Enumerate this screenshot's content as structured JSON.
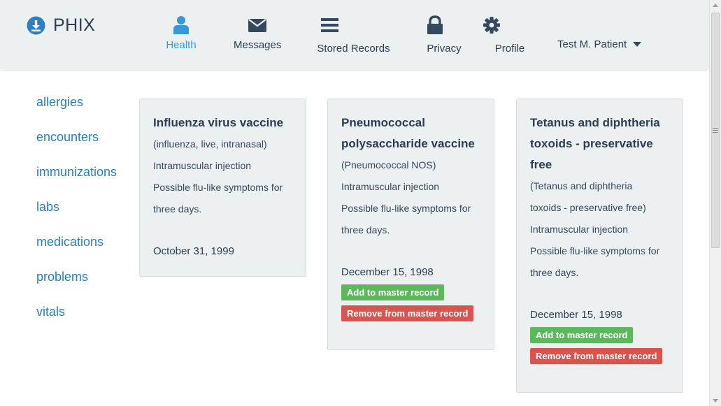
{
  "brand": {
    "name": "PHIX",
    "icon": "download-circle-icon"
  },
  "nav": {
    "items": [
      {
        "label": "Health",
        "icon": "user-icon",
        "active": true
      },
      {
        "label": "Messages",
        "icon": "envelope-icon"
      },
      {
        "label": "Stored Records",
        "icon": "list-icon"
      },
      {
        "label": "Privacy",
        "icon": "lock-icon"
      },
      {
        "label": "Profile",
        "icon": "gear-icon"
      }
    ],
    "user": "Test M. Patient"
  },
  "sidebar": {
    "items": [
      "allergies",
      "encounters",
      "immunizations",
      "labs",
      "medications",
      "problems",
      "vitals"
    ]
  },
  "cards": [
    {
      "title": "Influenza virus vaccine",
      "lines": [
        "(influenza, live, intranasal)",
        "Intramuscular injection",
        "Possible flu-like symptoms for",
        "three days."
      ],
      "date": "October 31, 1999"
    },
    {
      "title_lines": [
        "Pneumococcal",
        "polysaccharide vaccine"
      ],
      "lines": [
        "(Pneumococcal NOS)",
        "Intramuscular injection",
        "Possible flu-like symptoms for",
        "three days."
      ],
      "date": "December 15, 1998",
      "add_label": "Add to master record",
      "remove_label": "Remove from master record"
    },
    {
      "title_lines": [
        "Tetanus and diphtheria",
        "toxoids - preservative",
        "free"
      ],
      "lines": [
        "(Tetanus and diphtheria",
        "toxoids - preservative free)",
        "Intramuscular injection",
        "Possible flu-like symptoms for",
        "three days."
      ],
      "date": "December 15, 1998",
      "add_label": "Add to master record",
      "remove_label": "Remove from master record"
    }
  ],
  "colors": {
    "accent": "#3498db",
    "link": "#2980b9",
    "navbar_bg": "#ecf0f1",
    "success": "#5cb85c",
    "danger": "#d9534f"
  }
}
